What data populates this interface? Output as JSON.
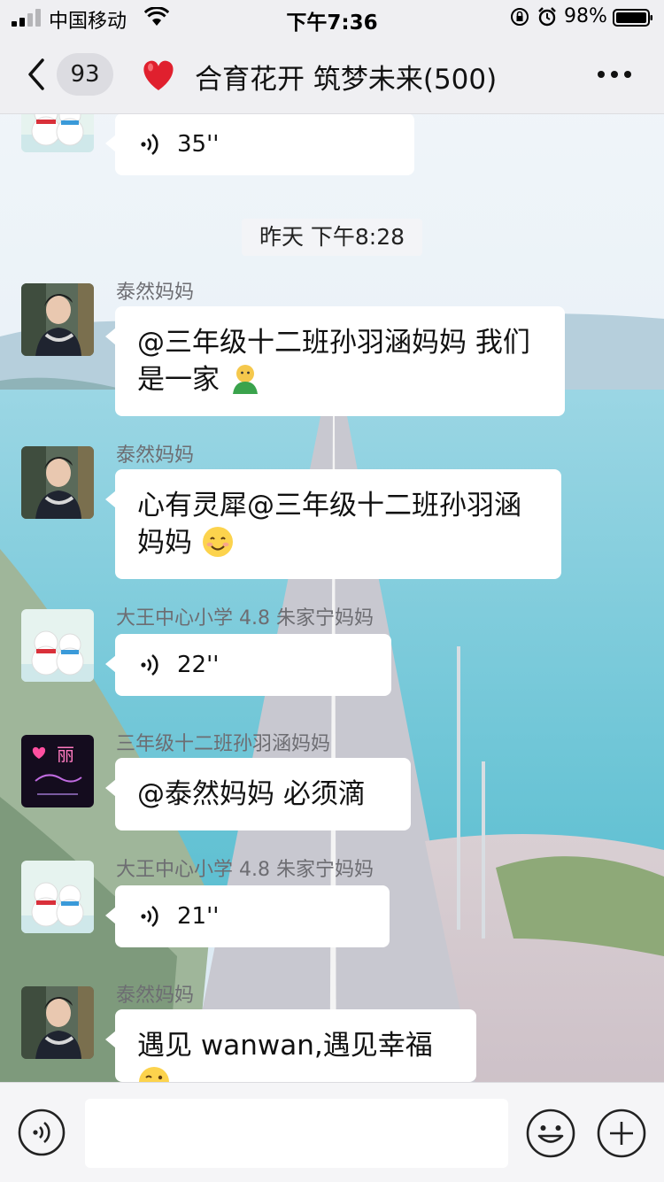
{
  "status_bar": {
    "carrier": "中国移动",
    "time": "下午7:36",
    "battery": "98%"
  },
  "header": {
    "unread_count": "93",
    "title": "合育花开 筑梦未来(500)"
  },
  "chat": {
    "top_voice_duration": "35''",
    "time_divider": "昨天 下午8:28",
    "messages": [
      {
        "sender": "泰然妈妈",
        "text": "@三年级十二班孙羽涵妈妈 我们是一家",
        "avatar_icon": "woman-photo-avatar",
        "emoji_icon": "green-shirt-person-emoji"
      },
      {
        "sender": "泰然妈妈",
        "text": "心有灵犀@三年级十二班孙羽涵妈妈",
        "avatar_icon": "woman-photo-avatar",
        "emoji_icon": "smiling-face-emoji"
      },
      {
        "sender": "大王中心小学 4.8 朱家宁妈妈",
        "voice_duration": "22''",
        "avatar_icon": "snowmen-avatar"
      },
      {
        "sender": "三年级十二班孙羽涵妈妈",
        "text": "@泰然妈妈 必须滴",
        "avatar_icon": "neon-heart-avatar",
        "avatar_text": "丽"
      },
      {
        "sender": "大王中心小学 4.8 朱家宁妈妈",
        "voice_duration": "21''",
        "avatar_icon": "snowmen-avatar"
      },
      {
        "sender": "泰然妈妈",
        "text": "遇见 wanwan,遇见幸福",
        "avatar_icon": "woman-photo-avatar",
        "emoji_icon": "winking-tongue-face-emoji"
      }
    ]
  },
  "colors": {
    "header_bg": "#efeff2",
    "bubble_bg": "#ffffff",
    "sender_text": "#6d6d72",
    "heart": "#e0202e",
    "sea": "#74c9d8"
  }
}
